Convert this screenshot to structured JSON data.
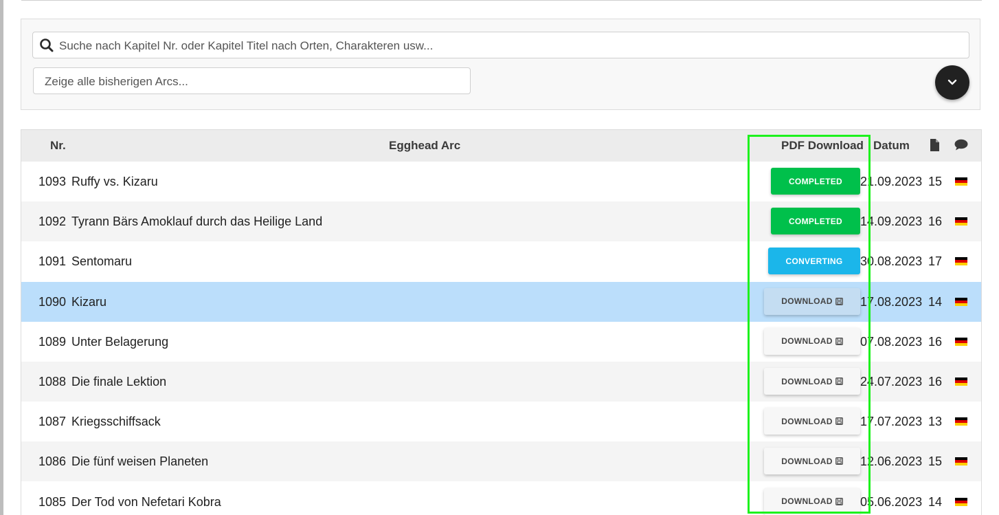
{
  "search": {
    "placeholder": "Suche nach Kapitel Nr. oder Kapitel Titel nach Orten, Charakteren usw...",
    "arc_placeholder": "Zeige alle bisherigen Arcs..."
  },
  "table": {
    "headers": {
      "nr": "Nr.",
      "arc": "Egghead Arc",
      "pdf": "PDF Download",
      "datum": "Datum",
      "pages_icon": "document-icon",
      "comments_icon": "comment-icon"
    },
    "rows": [
      {
        "nr": "1093",
        "title": "Ruffy vs. Kizaru",
        "status": "COMPLETED",
        "date": "21.09.2023",
        "pages": "15"
      },
      {
        "nr": "1092",
        "title": "Tyrann Bärs Amoklauf durch das Heilige Land",
        "status": "COMPLETED",
        "date": "14.09.2023",
        "pages": "16"
      },
      {
        "nr": "1091",
        "title": "Sentomaru",
        "status": "CONVERTING",
        "date": "30.08.2023",
        "pages": "17"
      },
      {
        "nr": "1090",
        "title": "Kizaru",
        "status": "DOWNLOAD",
        "date": "17.08.2023",
        "pages": "14"
      },
      {
        "nr": "1089",
        "title": "Unter Belagerung",
        "status": "DOWNLOAD",
        "date": "07.08.2023",
        "pages": "16"
      },
      {
        "nr": "1088",
        "title": "Die finale Lektion",
        "status": "DOWNLOAD",
        "date": "24.07.2023",
        "pages": "16"
      },
      {
        "nr": "1087",
        "title": "Kriegsschiffsack",
        "status": "DOWNLOAD",
        "date": "17.07.2023",
        "pages": "13"
      },
      {
        "nr": "1086",
        "title": "Die fünf weisen Planeten",
        "status": "DOWNLOAD",
        "date": "12.06.2023",
        "pages": "15"
      },
      {
        "nr": "1085",
        "title": "Der Tod von Nefetari Kobra",
        "status": "DOWNLOAD",
        "date": "05.06.2023",
        "pages": "14"
      }
    ]
  },
  "colors": {
    "completed": "#00c04b",
    "converting": "#1bb6ea",
    "download": "#f7f7f7",
    "selected_row": "#bbdefb",
    "highlight": "#1df21d",
    "flag_black": "#000000",
    "flag_red": "#dd0000",
    "flag_gold": "#ffce00"
  },
  "icons": {
    "search": "search-icon",
    "expand": "chevron-down-icon",
    "save": "save-icon",
    "flag": "german-flag-icon"
  }
}
